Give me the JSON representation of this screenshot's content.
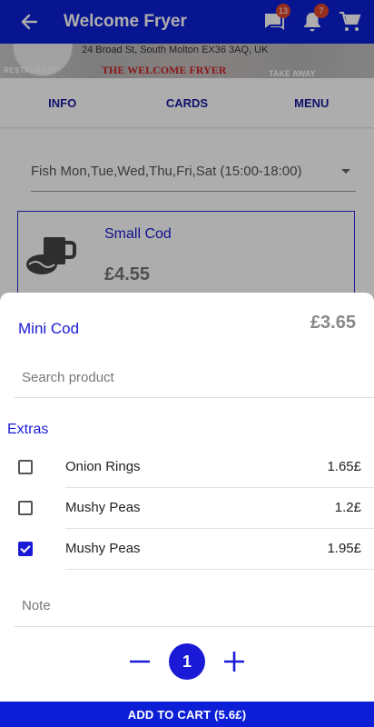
{
  "appbar": {
    "title": "Welcome Fryer",
    "messages_badge": "13",
    "notifications_badge": "7"
  },
  "banner": {
    "address": "24 Broad St, South Molton EX36 3AQ, UK",
    "sign_left": "RESTAURANT",
    "sign_center": "THE WELCOME FRYER",
    "sign_right": "TAKE AWAY"
  },
  "tabs": [
    {
      "label": "INFO"
    },
    {
      "label": "CARDS"
    },
    {
      "label": "MENU"
    }
  ],
  "menu_select": {
    "value": "Fish Mon,Tue,Wed,Thu,Fri,Sat (15:00-18:00)"
  },
  "product_card": {
    "name": "Small Cod",
    "price": "£4.55"
  },
  "sheet": {
    "title": "Mini Cod",
    "price": "£3.65",
    "search_placeholder": "Search product",
    "extras_label": "Extras",
    "extras": [
      {
        "name": "Onion Rings",
        "price": "1.65£",
        "checked": false
      },
      {
        "name": "Mushy Peas",
        "price": "1.2£",
        "checked": false
      },
      {
        "name": "Mushy Peas",
        "price": "1.95£",
        "checked": true
      }
    ],
    "note_placeholder": "Note",
    "quantity": "1",
    "add_button": "ADD TO CART (5.6£)"
  },
  "colors": {
    "primary": "#0c1fd6",
    "accent_text": "#1a1ad6",
    "badge": "#e0442a"
  }
}
